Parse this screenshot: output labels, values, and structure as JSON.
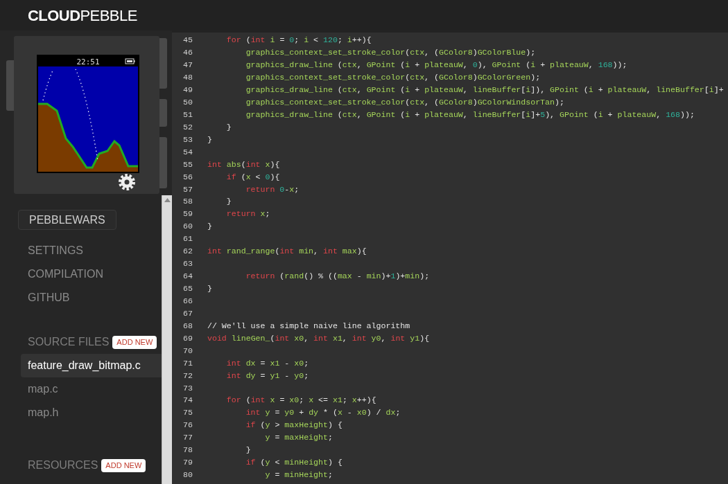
{
  "header": {
    "logo": "**CLOUD**PEBBLE"
  },
  "emulator": {
    "time": "22:51"
  },
  "sidebar": {
    "project": "PEBBLEWARS",
    "nav": [
      "SETTINGS",
      "COMPILATION",
      "GITHUB"
    ],
    "sections": [
      {
        "title": "SOURCE FILES",
        "button": "ADD NEW",
        "items": [
          {
            "label": "feature_draw_bitmap.c",
            "selected": true
          },
          {
            "label": "map.c",
            "selected": false
          },
          {
            "label": "map.h",
            "selected": false
          }
        ]
      },
      {
        "title": "RESOURCES",
        "button": "ADD NEW"
      }
    ]
  },
  "editor": {
    "lines": [
      {
        "number": "45",
        "tokens": [
          {
            "kind": "kw",
            "text": "    for"
          },
          {
            "kind": "pun",
            "text": " ("
          },
          {
            "kind": "kw",
            "text": "int"
          },
          {
            "kind": "id",
            "text": " i"
          },
          {
            "kind": "pun",
            "text": " = "
          },
          {
            "kind": "num",
            "text": "0"
          },
          {
            "kind": "pun",
            "text": "; "
          },
          {
            "kind": "id",
            "text": "i"
          },
          {
            "kind": "pun",
            "text": " < "
          },
          {
            "kind": "num",
            "text": "120"
          },
          {
            "kind": "pun",
            "text": "; "
          },
          {
            "kind": "id",
            "text": "i"
          },
          {
            "kind": "pun",
            "text": "++){"
          }
        ]
      },
      {
        "number": "46",
        "tokens": [
          {
            "kind": "id",
            "text": "        graphics_context_set_stroke_color"
          },
          {
            "kind": "pun",
            "text": "("
          },
          {
            "kind": "id",
            "text": "ctx"
          },
          {
            "kind": "pun",
            "text": ", ("
          },
          {
            "kind": "id",
            "text": "GColor8"
          },
          {
            "kind": "pun",
            "text": ")"
          },
          {
            "kind": "id",
            "text": "GColorBlue"
          },
          {
            "kind": "pun",
            "text": ");"
          }
        ]
      },
      {
        "number": "47",
        "tokens": [
          {
            "kind": "id",
            "text": "        graphics_draw_line"
          },
          {
            "kind": "pun",
            "text": " ("
          },
          {
            "kind": "id",
            "text": "ctx"
          },
          {
            "kind": "pun",
            "text": ", "
          },
          {
            "kind": "id",
            "text": "GPoint"
          },
          {
            "kind": "pun",
            "text": " ("
          },
          {
            "kind": "id",
            "text": "i"
          },
          {
            "kind": "pun",
            "text": " + "
          },
          {
            "kind": "id",
            "text": "plateauW"
          },
          {
            "kind": "pun",
            "text": ", "
          },
          {
            "kind": "num",
            "text": "0"
          },
          {
            "kind": "pun",
            "text": "), "
          },
          {
            "kind": "id",
            "text": "GPoint"
          },
          {
            "kind": "pun",
            "text": " ("
          },
          {
            "kind": "id",
            "text": "i"
          },
          {
            "kind": "pun",
            "text": " + "
          },
          {
            "kind": "id",
            "text": "plateauW"
          },
          {
            "kind": "pun",
            "text": ", "
          },
          {
            "kind": "num",
            "text": "168"
          },
          {
            "kind": "pun",
            "text": "));"
          }
        ]
      },
      {
        "number": "48",
        "tokens": [
          {
            "kind": "id",
            "text": "        graphics_context_set_stroke_color"
          },
          {
            "kind": "pun",
            "text": "("
          },
          {
            "kind": "id",
            "text": "ctx"
          },
          {
            "kind": "pun",
            "text": ", ("
          },
          {
            "kind": "id",
            "text": "GColor8"
          },
          {
            "kind": "pun",
            "text": ")"
          },
          {
            "kind": "id",
            "text": "GColorGreen"
          },
          {
            "kind": "pun",
            "text": ");"
          }
        ]
      },
      {
        "number": "49",
        "tokens": [
          {
            "kind": "id",
            "text": "        graphics_draw_line"
          },
          {
            "kind": "pun",
            "text": " ("
          },
          {
            "kind": "id",
            "text": "ctx"
          },
          {
            "kind": "pun",
            "text": ", "
          },
          {
            "kind": "id",
            "text": "GPoint"
          },
          {
            "kind": "pun",
            "text": " ("
          },
          {
            "kind": "id",
            "text": "i"
          },
          {
            "kind": "pun",
            "text": " + "
          },
          {
            "kind": "id",
            "text": "plateauW"
          },
          {
            "kind": "pun",
            "text": ", "
          },
          {
            "kind": "id",
            "text": "lineBuffer"
          },
          {
            "kind": "pun",
            "text": "["
          },
          {
            "kind": "id",
            "text": "i"
          },
          {
            "kind": "pun",
            "text": "]), "
          },
          {
            "kind": "id",
            "text": "GPoint"
          },
          {
            "kind": "pun",
            "text": " ("
          },
          {
            "kind": "id",
            "text": "i"
          },
          {
            "kind": "pun",
            "text": " + "
          },
          {
            "kind": "id",
            "text": "plateauW"
          },
          {
            "kind": "pun",
            "text": ", "
          },
          {
            "kind": "id",
            "text": "lineBuffer"
          },
          {
            "kind": "pun",
            "text": "["
          },
          {
            "kind": "id",
            "text": "i"
          },
          {
            "kind": "pun",
            "text": "]+"
          }
        ]
      },
      {
        "number": "50",
        "tokens": [
          {
            "kind": "id",
            "text": "        graphics_context_set_stroke_color"
          },
          {
            "kind": "pun",
            "text": "("
          },
          {
            "kind": "id",
            "text": "ctx"
          },
          {
            "kind": "pun",
            "text": ", ("
          },
          {
            "kind": "id",
            "text": "GColor8"
          },
          {
            "kind": "pun",
            "text": ")"
          },
          {
            "kind": "id",
            "text": "GColorWindsorTan"
          },
          {
            "kind": "pun",
            "text": ");"
          }
        ]
      },
      {
        "number": "51",
        "tokens": [
          {
            "kind": "id",
            "text": "        graphics_draw_line"
          },
          {
            "kind": "pun",
            "text": " ("
          },
          {
            "kind": "id",
            "text": "ctx"
          },
          {
            "kind": "pun",
            "text": ", "
          },
          {
            "kind": "id",
            "text": "GPoint"
          },
          {
            "kind": "pun",
            "text": " ("
          },
          {
            "kind": "id",
            "text": "i"
          },
          {
            "kind": "pun",
            "text": " + "
          },
          {
            "kind": "id",
            "text": "plateauW"
          },
          {
            "kind": "pun",
            "text": ", "
          },
          {
            "kind": "id",
            "text": "lineBuffer"
          },
          {
            "kind": "pun",
            "text": "["
          },
          {
            "kind": "id",
            "text": "i"
          },
          {
            "kind": "pun",
            "text": "]+"
          },
          {
            "kind": "num",
            "text": "5"
          },
          {
            "kind": "pun",
            "text": "), "
          },
          {
            "kind": "id",
            "text": "GPoint"
          },
          {
            "kind": "pun",
            "text": " ("
          },
          {
            "kind": "id",
            "text": "i"
          },
          {
            "kind": "pun",
            "text": " + "
          },
          {
            "kind": "id",
            "text": "plateauW"
          },
          {
            "kind": "pun",
            "text": ", "
          },
          {
            "kind": "num",
            "text": "168"
          },
          {
            "kind": "pun",
            "text": "));"
          }
        ]
      },
      {
        "number": "52",
        "tokens": [
          {
            "kind": "pun",
            "text": "    }"
          }
        ]
      },
      {
        "number": "53",
        "tokens": [
          {
            "kind": "pun",
            "text": "}"
          }
        ]
      },
      {
        "number": "54"
      },
      {
        "number": "55",
        "tokens": [
          {
            "kind": "kw",
            "text": "int"
          },
          {
            "kind": "id",
            "text": " abs"
          },
          {
            "kind": "pun",
            "text": "("
          },
          {
            "kind": "kw",
            "text": "int"
          },
          {
            "kind": "id",
            "text": " x"
          },
          {
            "kind": "pun",
            "text": "){"
          }
        ]
      },
      {
        "number": "56",
        "tokens": [
          {
            "kind": "kw",
            "text": "    if"
          },
          {
            "kind": "pun",
            "text": " ("
          },
          {
            "kind": "id",
            "text": "x"
          },
          {
            "kind": "pun",
            "text": " < "
          },
          {
            "kind": "num",
            "text": "0"
          },
          {
            "kind": "pun",
            "text": "){"
          }
        ]
      },
      {
        "number": "57",
        "tokens": [
          {
            "kind": "kw",
            "text": "        return"
          },
          {
            "kind": "num",
            "text": " 0"
          },
          {
            "kind": "pun",
            "text": "-"
          },
          {
            "kind": "id",
            "text": "x"
          },
          {
            "kind": "pun",
            "text": ";"
          }
        ]
      },
      {
        "number": "58",
        "tokens": [
          {
            "kind": "pun",
            "text": "    }"
          }
        ]
      },
      {
        "number": "59",
        "tokens": [
          {
            "kind": "kw",
            "text": "    return"
          },
          {
            "kind": "id",
            "text": " x"
          },
          {
            "kind": "pun",
            "text": ";"
          }
        ]
      },
      {
        "number": "60",
        "tokens": [
          {
            "kind": "pun",
            "text": "}"
          }
        ]
      },
      {
        "number": "61"
      },
      {
        "number": "62",
        "tokens": [
          {
            "kind": "kw",
            "text": "int"
          },
          {
            "kind": "id",
            "text": " rand_range"
          },
          {
            "kind": "pun",
            "text": "("
          },
          {
            "kind": "kw",
            "text": "int"
          },
          {
            "kind": "id",
            "text": " min"
          },
          {
            "kind": "pun",
            "text": ", "
          },
          {
            "kind": "kw",
            "text": "int"
          },
          {
            "kind": "id",
            "text": " max"
          },
          {
            "kind": "pun",
            "text": "){"
          }
        ]
      },
      {
        "number": "63"
      },
      {
        "number": "64",
        "tokens": [
          {
            "kind": "kw",
            "text": "        return"
          },
          {
            "kind": "pun",
            "text": " ("
          },
          {
            "kind": "id",
            "text": "rand"
          },
          {
            "kind": "pun",
            "text": "() % (("
          },
          {
            "kind": "id",
            "text": "max"
          },
          {
            "kind": "pun",
            "text": " - "
          },
          {
            "kind": "id",
            "text": "min"
          },
          {
            "kind": "pun",
            "text": ")+"
          },
          {
            "kind": "num",
            "text": "1"
          },
          {
            "kind": "pun",
            "text": ")+"
          },
          {
            "kind": "id",
            "text": "min"
          },
          {
            "kind": "pun",
            "text": ");"
          }
        ]
      },
      {
        "number": "65",
        "tokens": [
          {
            "kind": "pun",
            "text": "}"
          }
        ]
      },
      {
        "number": "66"
      },
      {
        "number": "67"
      },
      {
        "number": "68",
        "tokens": [
          {
            "kind": "com",
            "text": "// We'll use a simple naive line algorithm"
          }
        ]
      },
      {
        "number": "69",
        "tokens": [
          {
            "kind": "kw",
            "text": "void"
          },
          {
            "kind": "id",
            "text": " lineGen_"
          },
          {
            "kind": "pun",
            "text": "("
          },
          {
            "kind": "kw",
            "text": "int"
          },
          {
            "kind": "id",
            "text": " x0"
          },
          {
            "kind": "pun",
            "text": ", "
          },
          {
            "kind": "kw",
            "text": "int"
          },
          {
            "kind": "id",
            "text": " x1"
          },
          {
            "kind": "pun",
            "text": ", "
          },
          {
            "kind": "kw",
            "text": "int"
          },
          {
            "kind": "id",
            "text": " y0"
          },
          {
            "kind": "pun",
            "text": ", "
          },
          {
            "kind": "kw",
            "text": "int"
          },
          {
            "kind": "id",
            "text": " y1"
          },
          {
            "kind": "pun",
            "text": "){"
          }
        ]
      },
      {
        "number": "70"
      },
      {
        "number": "71",
        "tokens": [
          {
            "kind": "kw",
            "text": "    int"
          },
          {
            "kind": "id",
            "text": " dx"
          },
          {
            "kind": "pun",
            "text": " = "
          },
          {
            "kind": "id",
            "text": "x1"
          },
          {
            "kind": "pun",
            "text": " - "
          },
          {
            "kind": "id",
            "text": "x0"
          },
          {
            "kind": "pun",
            "text": ";"
          }
        ]
      },
      {
        "number": "72",
        "tokens": [
          {
            "kind": "kw",
            "text": "    int"
          },
          {
            "kind": "id",
            "text": " dy"
          },
          {
            "kind": "pun",
            "text": " = "
          },
          {
            "kind": "id",
            "text": "y1"
          },
          {
            "kind": "pun",
            "text": " - "
          },
          {
            "kind": "id",
            "text": "y0"
          },
          {
            "kind": "pun",
            "text": ";"
          }
        ]
      },
      {
        "number": "73"
      },
      {
        "number": "74",
        "tokens": [
          {
            "kind": "kw",
            "text": "    for"
          },
          {
            "kind": "pun",
            "text": " ("
          },
          {
            "kind": "kw",
            "text": "int"
          },
          {
            "kind": "id",
            "text": " x"
          },
          {
            "kind": "pun",
            "text": " = "
          },
          {
            "kind": "id",
            "text": "x0"
          },
          {
            "kind": "pun",
            "text": "; "
          },
          {
            "kind": "id",
            "text": "x"
          },
          {
            "kind": "pun",
            "text": " <= "
          },
          {
            "kind": "id",
            "text": "x1"
          },
          {
            "kind": "pun",
            "text": "; "
          },
          {
            "kind": "id",
            "text": "x"
          },
          {
            "kind": "pun",
            "text": "++){"
          }
        ]
      },
      {
        "number": "75",
        "tokens": [
          {
            "kind": "kw",
            "text": "        int"
          },
          {
            "kind": "id",
            "text": " y"
          },
          {
            "kind": "pun",
            "text": " = "
          },
          {
            "kind": "id",
            "text": "y0"
          },
          {
            "kind": "pun",
            "text": " + "
          },
          {
            "kind": "id",
            "text": "dy"
          },
          {
            "kind": "pun",
            "text": " * ("
          },
          {
            "kind": "id",
            "text": "x"
          },
          {
            "kind": "pun",
            "text": " - "
          },
          {
            "kind": "id",
            "text": "x0"
          },
          {
            "kind": "pun",
            "text": ") / "
          },
          {
            "kind": "id",
            "text": "dx"
          },
          {
            "kind": "pun",
            "text": ";"
          }
        ]
      },
      {
        "number": "76",
        "tokens": [
          {
            "kind": "kw",
            "text": "        if"
          },
          {
            "kind": "pun",
            "text": " ("
          },
          {
            "kind": "id",
            "text": "y"
          },
          {
            "kind": "pun",
            "text": " > "
          },
          {
            "kind": "id",
            "text": "maxHeight"
          },
          {
            "kind": "pun",
            "text": ") {"
          }
        ]
      },
      {
        "number": "77",
        "tokens": [
          {
            "kind": "id",
            "text": "            y"
          },
          {
            "kind": "pun",
            "text": " = "
          },
          {
            "kind": "id",
            "text": "maxHeight"
          },
          {
            "kind": "pun",
            "text": ";"
          }
        ]
      },
      {
        "number": "78",
        "tokens": [
          {
            "kind": "pun",
            "text": "        }"
          }
        ]
      },
      {
        "number": "79",
        "tokens": [
          {
            "kind": "kw",
            "text": "        if"
          },
          {
            "kind": "pun",
            "text": " ("
          },
          {
            "kind": "id",
            "text": "y"
          },
          {
            "kind": "pun",
            "text": " < "
          },
          {
            "kind": "id",
            "text": "minHeight"
          },
          {
            "kind": "pun",
            "text": ") {"
          }
        ]
      },
      {
        "number": "80",
        "tokens": [
          {
            "kind": "id",
            "text": "            y"
          },
          {
            "kind": "pun",
            "text": " = "
          },
          {
            "kind": "id",
            "text": "minHeight"
          },
          {
            "kind": "pun",
            "text": ";"
          }
        ]
      }
    ]
  }
}
